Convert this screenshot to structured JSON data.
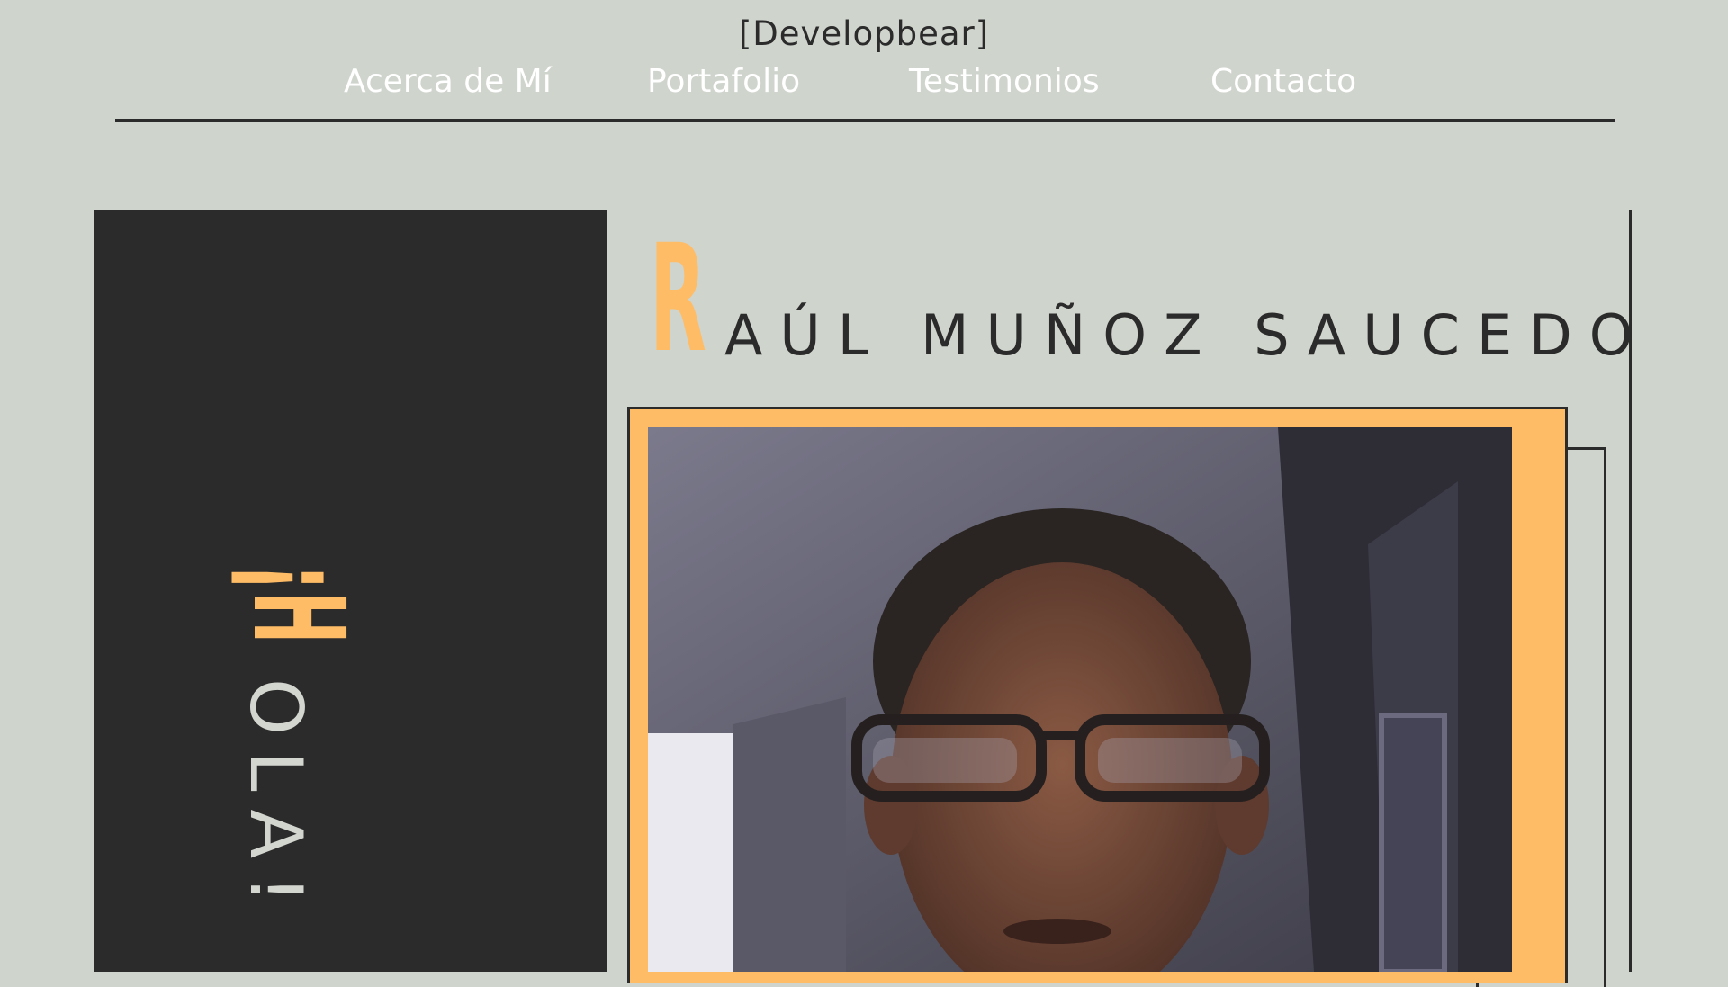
{
  "header": {
    "brand": "[Developbear]"
  },
  "nav": {
    "items": [
      {
        "label": "Acerca de Mí"
      },
      {
        "label": "Portafolio"
      },
      {
        "label": "Testimonios"
      },
      {
        "label": "Contacto"
      }
    ]
  },
  "hero": {
    "greeting_initial": "¡H",
    "greeting_rest": "OLA!",
    "name_initial": "R",
    "name_rest": "AÚL MUÑOZ SAUCEDO"
  },
  "colors": {
    "background": "#cfd4cc",
    "dark": "#2b2b2b",
    "accent": "#ffbc66"
  }
}
